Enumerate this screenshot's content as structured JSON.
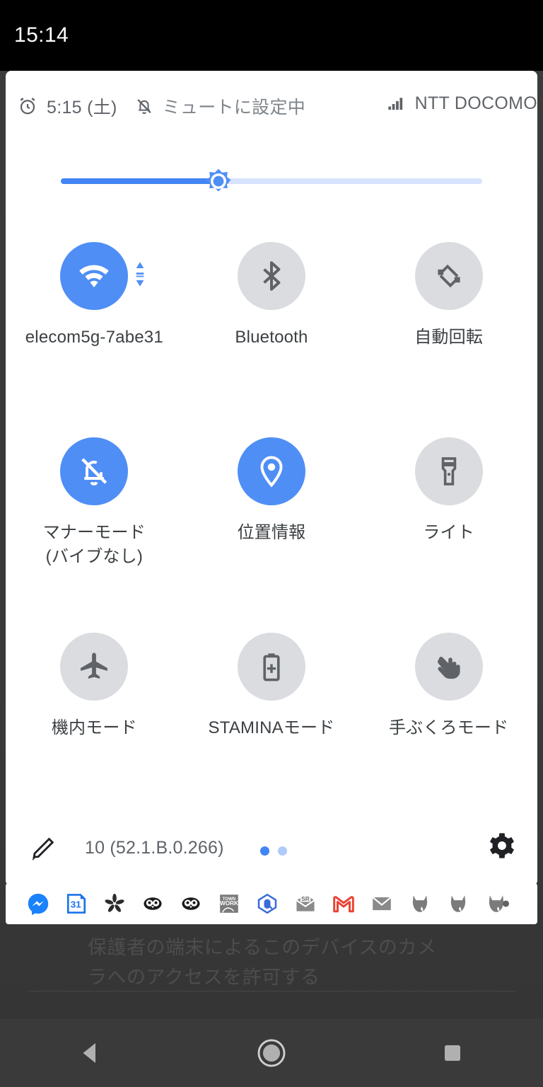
{
  "statusbar": {
    "clock": "15:14"
  },
  "panel": {
    "header": {
      "alarm_icon": "alarm-clock-icon",
      "alarm_time": "5:15 (土)",
      "ringer_icon": "bell-slash-icon",
      "ringer_status": "ミュートに設定中",
      "signal_icon": "signal-bars-icon",
      "carrier": "NTT DOCOMO"
    },
    "brightness": {
      "name": "brightness-slider",
      "value_percent": 40,
      "thumb_icon": "brightness-sun-icon",
      "fill_color": "#4285f4",
      "track_color": "#d7e3fc"
    },
    "tiles": [
      [
        {
          "label": "elecom5g-7abe31",
          "icon": "wifi-icon",
          "state": "on",
          "has_expand": true
        },
        {
          "label": "Bluetooth",
          "icon": "bluetooth-icon",
          "state": "off",
          "has_expand": false
        },
        {
          "label": "自動回転",
          "icon": "auto-rotate-icon",
          "state": "off",
          "has_expand": false
        }
      ],
      [
        {
          "label": "マナーモード\n(バイブなし)",
          "icon": "bell-slash-icon",
          "state": "on",
          "has_expand": false
        },
        {
          "label": "位置情報",
          "icon": "location-pin-icon",
          "state": "on",
          "has_expand": false
        },
        {
          "label": "ライト",
          "icon": "flashlight-icon",
          "state": "off",
          "has_expand": false
        }
      ],
      [
        {
          "label": "機内モード",
          "icon": "airplane-icon",
          "state": "off",
          "has_expand": false
        },
        {
          "label": "STAMINAモード",
          "icon": "battery-plus-icon",
          "state": "off",
          "has_expand": false
        },
        {
          "label": "手ぶくろモード",
          "icon": "glove-hand-icon",
          "state": "off",
          "has_expand": false
        }
      ]
    ],
    "footer": {
      "edit_icon": "pencil-edit-icon",
      "build_version": "10 (52.1.B.0.266)",
      "page_dots": [
        "active",
        "inactive"
      ],
      "settings_icon": "gear-icon"
    },
    "colors": {
      "tile_on": "#4f8ef5",
      "tile_off": "#dadce0",
      "icon_off": "#5f6368",
      "accent": "#4285f4"
    }
  },
  "notification_tray": {
    "icons": [
      "messenger-icon",
      "calendar-31-icon",
      "pinwheel-icon",
      "penguin-icon",
      "penguin-icon",
      "townwork-icon",
      "pentagon-home-icon",
      "open-mail-icon",
      "gmail-icon",
      "envelope-icon",
      "cat-icon",
      "cat-icon",
      "cat-icon"
    ],
    "overflow_icon": "overflow-dot-icon"
  },
  "backdrop": {
    "text": "保護者の端末によるこのデバイスのカメラへのアクセスを許可する"
  },
  "navbar": {
    "back_icon": "back-triangle-icon",
    "home_icon": "home-circle-icon",
    "recents_icon": "recents-square-icon"
  }
}
